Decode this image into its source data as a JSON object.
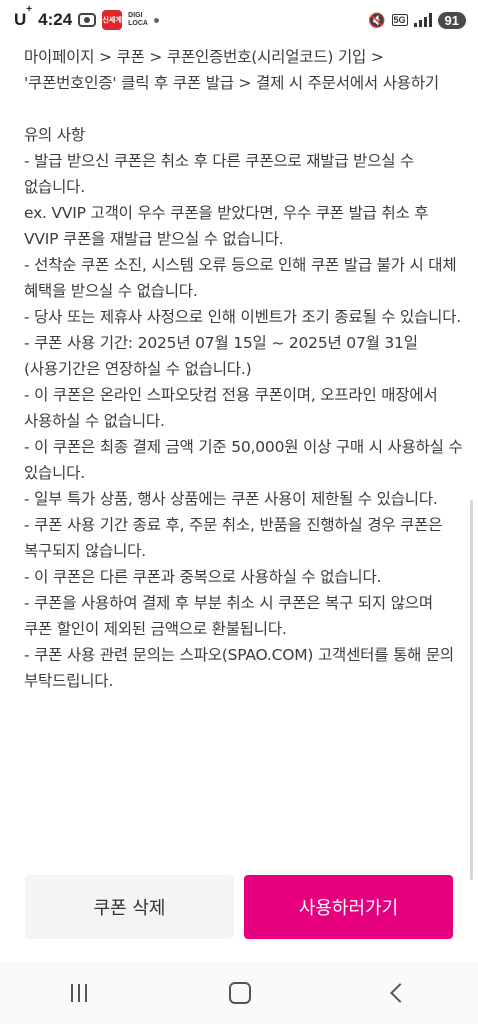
{
  "status_bar": {
    "carrier": "U",
    "carrier_sup": "+",
    "time": "4:24",
    "app_badge_text": "신세계",
    "app_mini_text": "DIGI\nLOCA",
    "network": "5G",
    "battery": "91"
  },
  "content": {
    "lines": [
      "- 쿠폰 번호 복사 후 '사용하러가기' 버튼 클릭 > 회원가입/로그인 > 마이페이지 > 쿠폰 > 쿠폰인증번호(시리얼코드) 기입 > '쿠폰번호인증' 클릭 후 쿠폰 발급 > 결제 시 주문서에서 사용하기"
    ],
    "notice_title": "유의 사항",
    "notices": [
      "- 발급 받으신 쿠폰은 취소 후 다른 쿠폰으로 재발급 받으실 수 없습니다.",
      "ex. VVIP 고객이 우수 쿠폰을 받았다면, 우수 쿠폰 발급 취소 후 VVIP 쿠폰을 재발급 받으실 수 없습니다.",
      "- 선착순 쿠폰 소진, 시스템 오류 등으로 인해 쿠폰 발급 불가 시 대체 혜택을 받으실 수 없습니다.",
      "- 당사 또는 제휴사 사정으로 인해 이벤트가 조기 종료될 수 있습니다.",
      "- 쿠폰 사용 기간: 2025년 07월 15일 ~ 2025년 07월 31일 (사용기간은 연장하실 수 없습니다.)",
      "- 이 쿠폰은 온라인 스파오닷컴 전용 쿠폰이며, 오프라인 매장에서 사용하실 수 없습니다.",
      "- 이 쿠폰은 최종 결제 금액 기준 50,000원 이상 구매 시 사용하실 수 있습니다.",
      "- 일부 특가 상품, 행사 상품에는 쿠폰 사용이 제한될 수 있습니다.",
      "- 쿠폰 사용 기간 종료 후, 주문 취소, 반품을 진행하실 경우 쿠폰은 복구되지 않습니다.",
      "- 이 쿠폰은 다른 쿠폰과 중복으로 사용하실 수 없습니다.",
      "- 쿠폰을 사용하여 결제 후 부분 취소 시 쿠폰은 복구 되지 않으며 쿠폰 할인이 제외된 금액으로 환불됩니다.",
      "- 쿠폰 사용 관련 문의는 스파오(SPAO.COM) 고객센터를 통해 문의 부탁드립니다."
    ]
  },
  "buttons": {
    "delete_label": "쿠폰 삭제",
    "use_label": "사용하러가기"
  },
  "colors": {
    "accent": "#e6007e",
    "secondary_button": "#f4f4f4"
  }
}
